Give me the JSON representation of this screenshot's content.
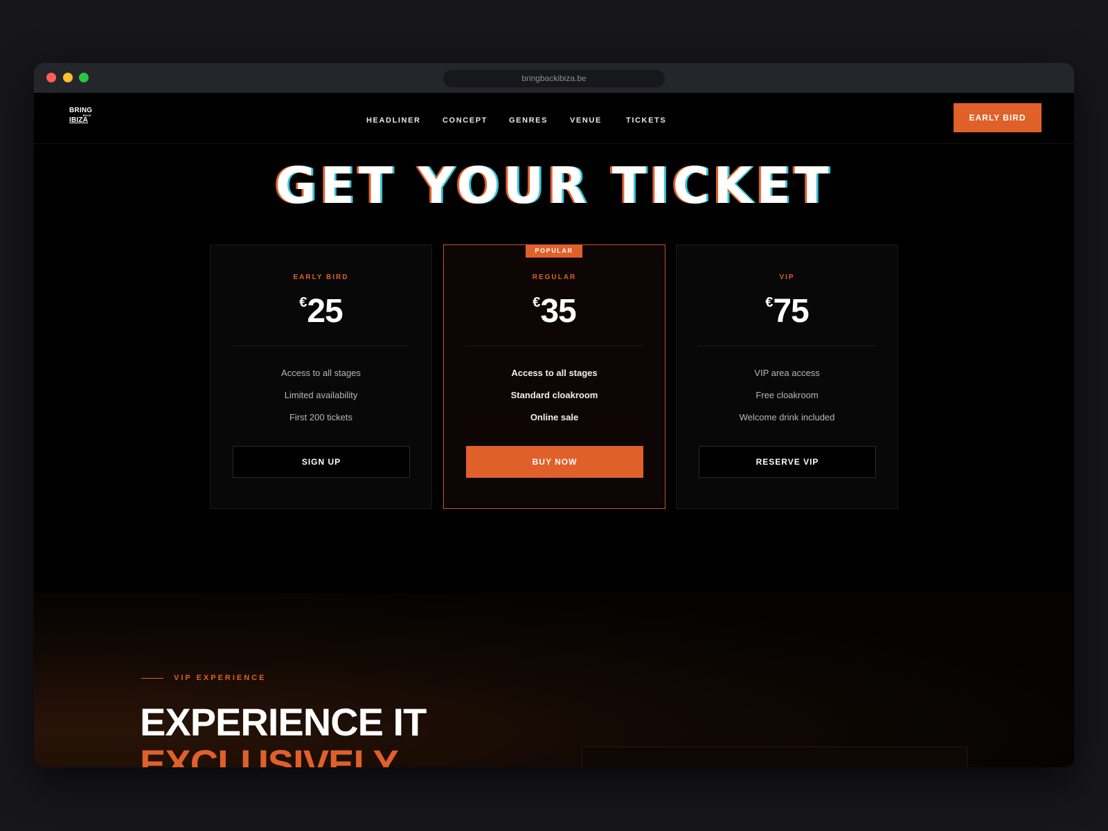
{
  "browser": {
    "url": "bringbackibiza.be"
  },
  "brand": {
    "logo_line1": "BRING",
    "logo_line2": "BACK",
    "logo_line3": "IBIZA"
  },
  "nav": {
    "items": [
      {
        "label": "HEADLINER"
      },
      {
        "label": "CONCEPT"
      },
      {
        "label": "GENRES"
      },
      {
        "label": "VENUE"
      },
      {
        "label": "TICKETS"
      }
    ],
    "cta_label": "EARLY BIRD"
  },
  "hero": {
    "title": "GET YOUR TICKET"
  },
  "tickets": [
    {
      "tier": "EARLY BIRD",
      "currency": "€",
      "amount": "25",
      "features": [
        "Access to all stages",
        "Limited availability",
        "First 200 tickets"
      ],
      "button": "SIGN UP"
    },
    {
      "badge": "POPULAR",
      "tier": "REGULAR",
      "currency": "€",
      "amount": "35",
      "features": [
        "Access to all stages",
        "Standard cloakroom",
        "Online sale"
      ],
      "button": "BUY NOW"
    },
    {
      "tier": "VIP",
      "currency": "€",
      "amount": "75",
      "features": [
        "VIP area access",
        "Free cloakroom",
        "Welcome drink included"
      ],
      "button": "RESERVE VIP"
    }
  ],
  "vip": {
    "eyebrow": "VIP EXPERIENCE",
    "heading_line1": "EXPERIENCE IT",
    "heading_line2": "EXCLUSIVELY"
  },
  "colors": {
    "accent": "#e0602a",
    "background": "#000000",
    "frame": "#16161b"
  }
}
